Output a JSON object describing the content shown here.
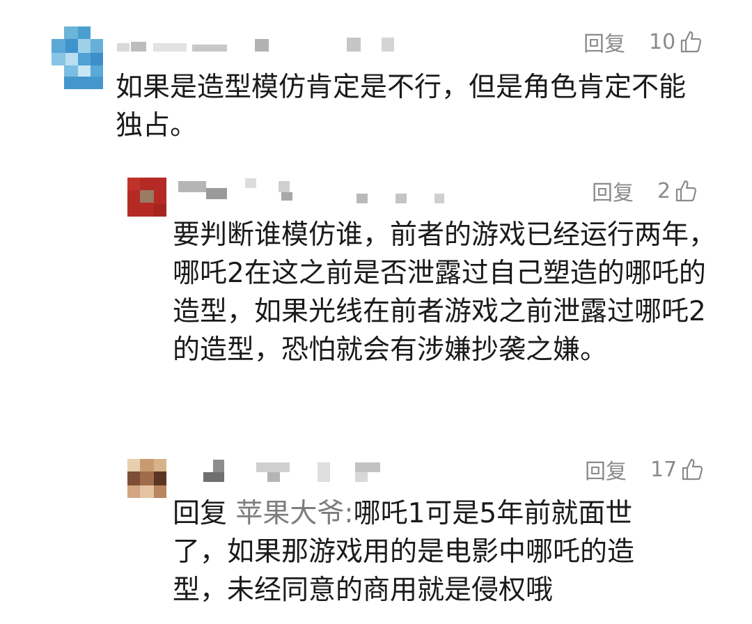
{
  "comments": [
    {
      "reply_label": "回复",
      "likes": "10",
      "text": "如果是造型模仿肯定是不行，但是角色肯定不能独占。"
    },
    {
      "reply_label": "回复",
      "likes": "2",
      "text": "要判断谁模仿谁，前者的游戏已经运行两年，哪吒2在这之前是否泄露过自己塑造的哪吒的造型，如果光线在前者游戏之前泄露过哪吒2的造型，恐怕就会有涉嫌抄袭之嫌。"
    },
    {
      "reply_label": "回复",
      "likes": "17",
      "reply_prefix": "回复",
      "mention": "苹果大爷:",
      "text": "哪吒1可是5年前就面世了，如果那游戏用的是电影中哪吒的造型，未经同意的商用就是侵权哦"
    }
  ],
  "icons": {
    "like": "thumbs-up-icon"
  },
  "colors": {
    "meta_gray": "#8a8a8a",
    "text": "#1a1a1a",
    "mention": "#7d7d7d"
  }
}
